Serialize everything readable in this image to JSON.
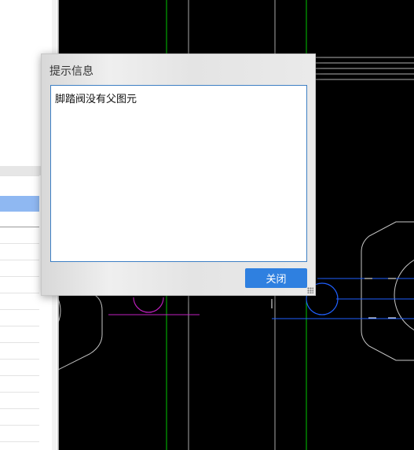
{
  "dialog": {
    "title": "提示信息",
    "message": "脚踏阀没有父图元",
    "close_label": "关闭"
  },
  "colors": {
    "canvas_bg": "#000000",
    "green_line": "#00c800",
    "blue_line": "#2060ff",
    "magenta_line": "#c020c0",
    "grey_line": "#b0b0b0",
    "accent_button": "#2f80e0"
  }
}
